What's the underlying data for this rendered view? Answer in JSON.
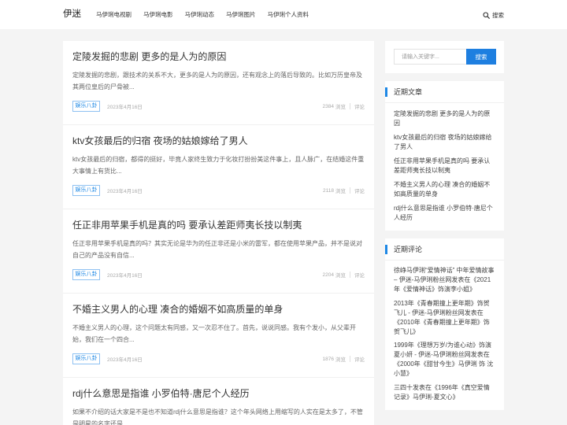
{
  "site": {
    "logo": "伊迷"
  },
  "nav": {
    "items": [
      {
        "label": "马伊琍电视剧"
      },
      {
        "label": "马伊琍电影"
      },
      {
        "label": "马伊琍动态"
      },
      {
        "label": "马伊琍图片"
      },
      {
        "label": "马伊琍个人资料"
      }
    ]
  },
  "header_search": {
    "icon": "search-icon",
    "label": "搜索"
  },
  "articles": [
    {
      "title": "定陵发掘的悲剧 更多的是人为的原因",
      "excerpt": "定陵发掘的悲剧，跟技术的关系不大，更多的是人为的原因，还有观念上的落后导致的。比如万历皇帝及其两位皇后的尸骨被...",
      "category": "娱乐八卦",
      "date": "2023年4月16日",
      "views": "2384"
    },
    {
      "title": "ktv女孩最后的归宿 夜场的姑娘嫁给了男人",
      "excerpt": "ktv女孩最后的归宿，都得的挺好，毕竟人家终生致力于化妆打扮扮美这件事上，且人脉广，在结婚这件重大事情上有货比...",
      "category": "娱乐八卦",
      "date": "2023年4月16日",
      "views": "2118"
    },
    {
      "title": "任正非用苹果手机是真的吗 要承认差距师夷长技以制夷",
      "excerpt": "任正非用苹果手机是真的吗？其实无论是华为的任正非还是小米的雷军，都在使用苹果产品，并不是说对自己的产品没有自信...",
      "category": "娱乐八卦",
      "date": "2023年4月16日",
      "views": "2204"
    },
    {
      "title": "不婚主义男人的心理 凑合的婚姻不如高质量的单身",
      "excerpt": "不婚主义男人的心理，这个问题太有同感，又一次忍不住了。首先，说说同感。我有个发小，从父辈开始，我们在一个四合...",
      "category": "娱乐八卦",
      "date": "2023年4月16日",
      "views": "1876"
    },
    {
      "title": "rdj什么意思是指谁 小罗伯特·唐尼个人经历",
      "excerpt": "如果不介绍的话大家是不是也不知道rdj什么意思是指谁？这个年头网络上用缩写的人实在是太多了，不管是明星的名字还是..."
    }
  ],
  "meta_labels": {
    "views": "浏览",
    "comments": "评论"
  },
  "sidebar": {
    "search": {
      "placeholder": "请输入关键字...",
      "button": "搜索"
    },
    "recent_posts": {
      "title": "近期文章",
      "items": [
        {
          "label": "定陵发掘的悲剧 更多的是人为的原因"
        },
        {
          "label": "ktv女孩最后的归宿 夜场的姑娘嫁给了男人"
        },
        {
          "label": "任正非用苹果手机是真的吗 要承认差距师夷长技以制夷"
        },
        {
          "label": "不婚主义男人的心理 凑合的婚姻不如高质量的单身"
        },
        {
          "label": "rdj什么意思是指谁 小罗伯特·唐尼个人经历"
        }
      ]
    },
    "recent_comments": {
      "title": "近期评论",
      "posted_on": "发表在《",
      "close": "》",
      "items": [
        {
          "author": "徐峥马伊琍“爱情神话” 中年爱情故事 – 伊迷-马伊琍粉丝网",
          "post": "2021年《爱情神话》饰演李小姐"
        },
        {
          "author": "2013年《青春期撞上更年期》饰贺飞儿 - 伊迷-马伊琍粉丝网",
          "post": "2010年《青春期撞上更年期》饰贺飞儿"
        },
        {
          "author": "1999年《理想万岁/为谁心动》饰演夏小妍 - 伊迷-马伊琍粉丝网",
          "post": "2000年《甜甘今生》马伊琍 饰 沈小慧"
        },
        {
          "author": "三四十",
          "post": "1996年《真空爱情记录》马伊琍-夏文心"
        }
      ]
    }
  },
  "colors": {
    "accent": "#1e88e5",
    "page_background": "#f4f4f4"
  }
}
